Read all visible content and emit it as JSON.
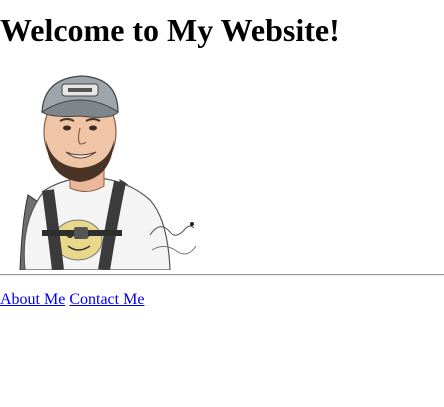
{
  "page": {
    "heading": "Welcome to My Website!"
  },
  "portrait": {
    "icon": "illustrated-portrait-man-with-cap-and-backpack"
  },
  "nav": {
    "about_label": "About Me",
    "contact_label": "Contact Me"
  },
  "colors": {
    "link": "#0000ee",
    "background": "#ffffff",
    "text": "#000000"
  }
}
